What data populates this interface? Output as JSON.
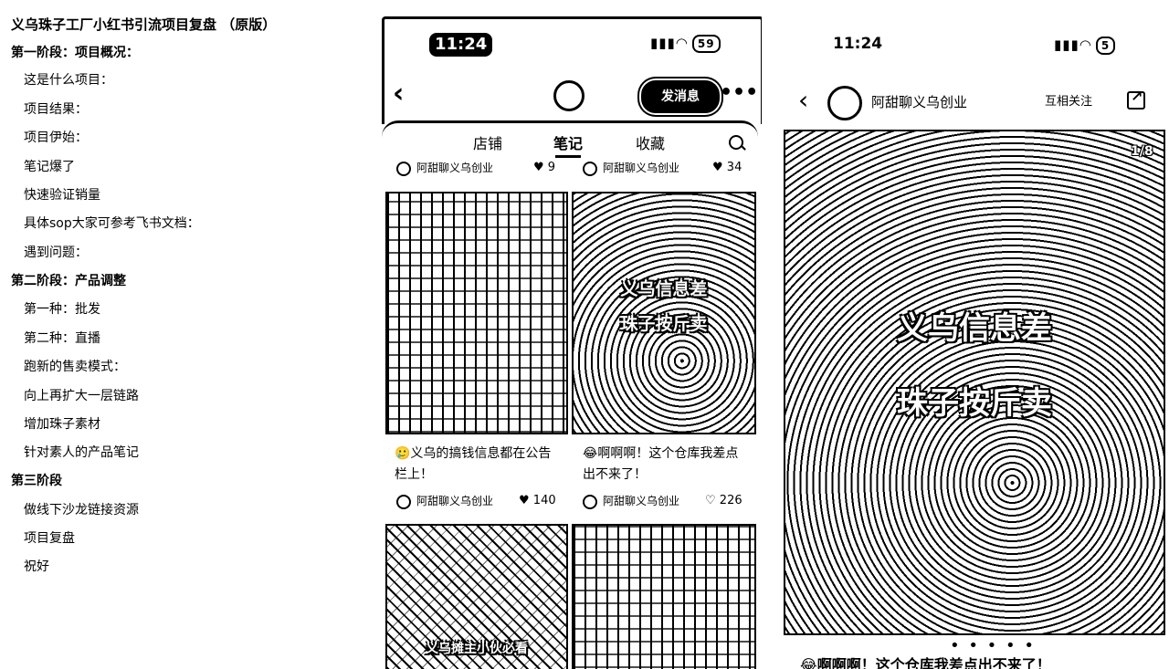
{
  "outline": {
    "title": "义乌珠子工厂小红书引流项目复盘 （原版）",
    "items": [
      {
        "level": 1,
        "text": "第一阶段：项目概况："
      },
      {
        "level": 2,
        "text": "这是什么项目："
      },
      {
        "level": 2,
        "text": "项目结果："
      },
      {
        "level": 2,
        "text": "项目伊始："
      },
      {
        "level": 2,
        "text": "笔记爆了"
      },
      {
        "level": 2,
        "text": "快速验证销量"
      },
      {
        "level": 2,
        "text": "具体sop大家可参考飞书文档："
      },
      {
        "level": 2,
        "text": "遇到问题："
      },
      {
        "level": 1,
        "text": "第二阶段：产品调整"
      },
      {
        "level": 2,
        "text": "第一种：批发"
      },
      {
        "level": 2,
        "text": "第二种：直播"
      },
      {
        "level": 2,
        "text": "跑新的售卖模式："
      },
      {
        "level": 2,
        "text": "向上再扩大一层链路"
      },
      {
        "level": 2,
        "text": "增加珠子素材"
      },
      {
        "level": 2,
        "text": "针对素人的产品笔记"
      },
      {
        "level": 1,
        "text": "第三阶段"
      },
      {
        "level": 2,
        "text": "做线下沙龙链接资源"
      },
      {
        "level": 2,
        "text": "项目复盘"
      },
      {
        "level": 2,
        "text": "祝好"
      }
    ]
  },
  "phone1": {
    "time": "11:24",
    "battery": "59",
    "send_message": "发消息",
    "more": "•••",
    "tabs": [
      "店铺",
      "笔记",
      "收藏"
    ],
    "active_tab": "笔记",
    "author": "阿甜聊义乌创业",
    "top_likes": [
      "9",
      "34"
    ],
    "cards": [
      {
        "title": "🥲义乌的搞钱信息都在公告栏上！",
        "likes": "140",
        "overlay": ""
      },
      {
        "title": "😂啊啊啊！这个仓库我差点出不来了！",
        "likes": "226",
        "overlay_line1": "义乌信息差",
        "overlay_line2": "珠子按斤卖"
      }
    ],
    "bottom_overlay": "义乌摊主小伙必看"
  },
  "phone2": {
    "time": "11:24",
    "battery": "5",
    "author": "阿甜聊义乌创业",
    "follow": "互相关注",
    "counter": "1/8",
    "overlay_line1": "义乌信息差",
    "overlay_line2": "珠子按斤卖",
    "dots": "• • • • •",
    "caption": "😂啊啊啊！这个仓库我差点出不来了！"
  },
  "icons": [
    "back-icon",
    "avatar-icon",
    "search-icon",
    "heart-icon",
    "share-icon",
    "signal-icon",
    "wifi-icon",
    "battery-icon"
  ]
}
